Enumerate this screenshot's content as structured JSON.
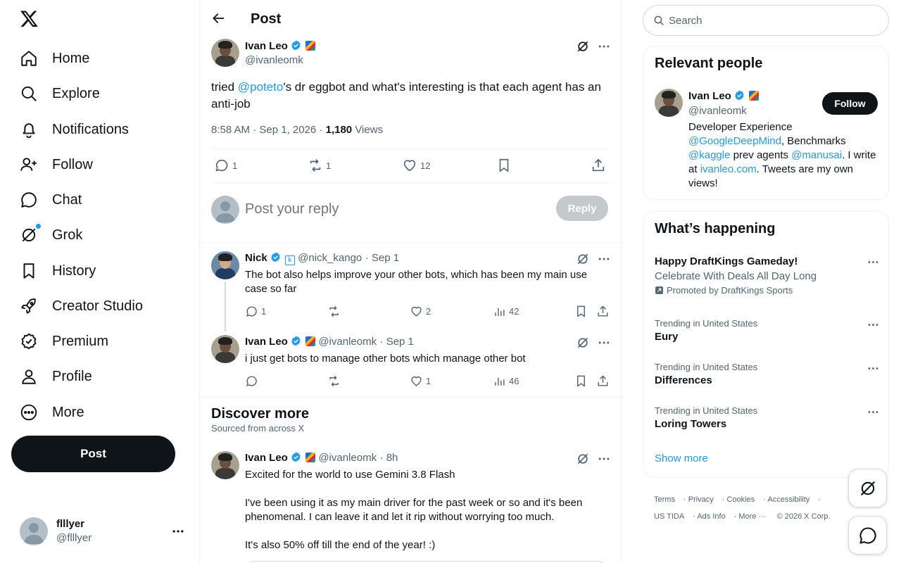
{
  "nav": {
    "items": [
      {
        "label": "Home"
      },
      {
        "label": "Explore"
      },
      {
        "label": "Notifications"
      },
      {
        "label": "Follow"
      },
      {
        "label": "Chat"
      },
      {
        "label": "Grok"
      },
      {
        "label": "History"
      },
      {
        "label": "Creator Studio"
      },
      {
        "label": "Premium"
      },
      {
        "label": "Profile"
      },
      {
        "label": "More"
      }
    ],
    "post_label": "Post"
  },
  "account": {
    "name": "flllyer",
    "handle": "@flllyer"
  },
  "header": {
    "title": "Post"
  },
  "main_post": {
    "author": "Ivan Leo",
    "handle": "@ivanleomk",
    "text_before": "tried ",
    "mention": "@poteto",
    "text_after": "'s dr eggbot and what's interesting is that each agent has an anti-job",
    "time": "8:58 AM · Sep 1, 2026 · ",
    "views_count": "1,180",
    "views_label": " Views",
    "replies": "1",
    "reposts": "1",
    "likes": "12"
  },
  "reply_box": {
    "placeholder": "Post your reply",
    "button": "Reply"
  },
  "replies": [
    {
      "author": "Nick",
      "handle": "@nick_kango",
      "time": "· Sep 1",
      "text": "The bot also helps improve your other bots, which has been my main use case so far",
      "replies": "1",
      "reposts": "",
      "likes": "2",
      "views": "42"
    },
    {
      "author": "Ivan Leo",
      "handle": "@ivanleomk",
      "time": "· Sep 1",
      "text": "i just get bots to manage other bots which manage other bot",
      "replies": "",
      "reposts": "",
      "likes": "1",
      "views": "46"
    }
  ],
  "discover": {
    "title": "Discover more",
    "subtitle": "Sourced from across X",
    "post": {
      "author": "Ivan Leo",
      "handle": "@ivanleomk",
      "time": "· 8h",
      "line1": "Excited for the world to use Gemini 3.8 Flash",
      "line2": "I've been using it as my main driver for the past week or so and it's been phenomenal. I can leave it and let it rip without worrying too much.",
      "line3": "It's also 50% off till the end of the year! :)"
    }
  },
  "search": {
    "placeholder": "Search"
  },
  "relevant": {
    "title": "Relevant people",
    "name": "Ivan Leo",
    "handle": "@ivanleomk",
    "follow": "Follow",
    "bio_1": "Developer Experience ",
    "bio_m1": "@GoogleDeepMind",
    "bio_2": ", Benchmarks ",
    "bio_m2": "@kaggle",
    "bio_3": " prev agents ",
    "bio_m3": "@manusai",
    "bio_4": ". I write at ",
    "bio_link": "ivanleo.com",
    "bio_5": ". Tweets are my own views!"
  },
  "happening": {
    "title": "What’s happening",
    "promo_title": "Happy DraftKings Gameday!",
    "promo_sub": "Celebrate With Deals All Day Long",
    "promo_by": "Promoted by DraftKings Sports",
    "trends": [
      {
        "context": "Trending in United States",
        "name": "Eury"
      },
      {
        "context": "Trending in United States",
        "name": "Differences"
      },
      {
        "context": "Trending in United States",
        "name": "Loring Towers"
      }
    ],
    "show_more": "Show more"
  },
  "footer": {
    "links": [
      "Terms",
      "Privacy",
      "Cookies",
      "Accessibility",
      "US TIDA",
      "Ads Info",
      "More ···",
      "© 2026 X Corp."
    ]
  },
  "colors": {
    "accent": "#1d9bf0",
    "text": "#0f1419",
    "secondary": "#536471",
    "border": "#eff3f4"
  }
}
